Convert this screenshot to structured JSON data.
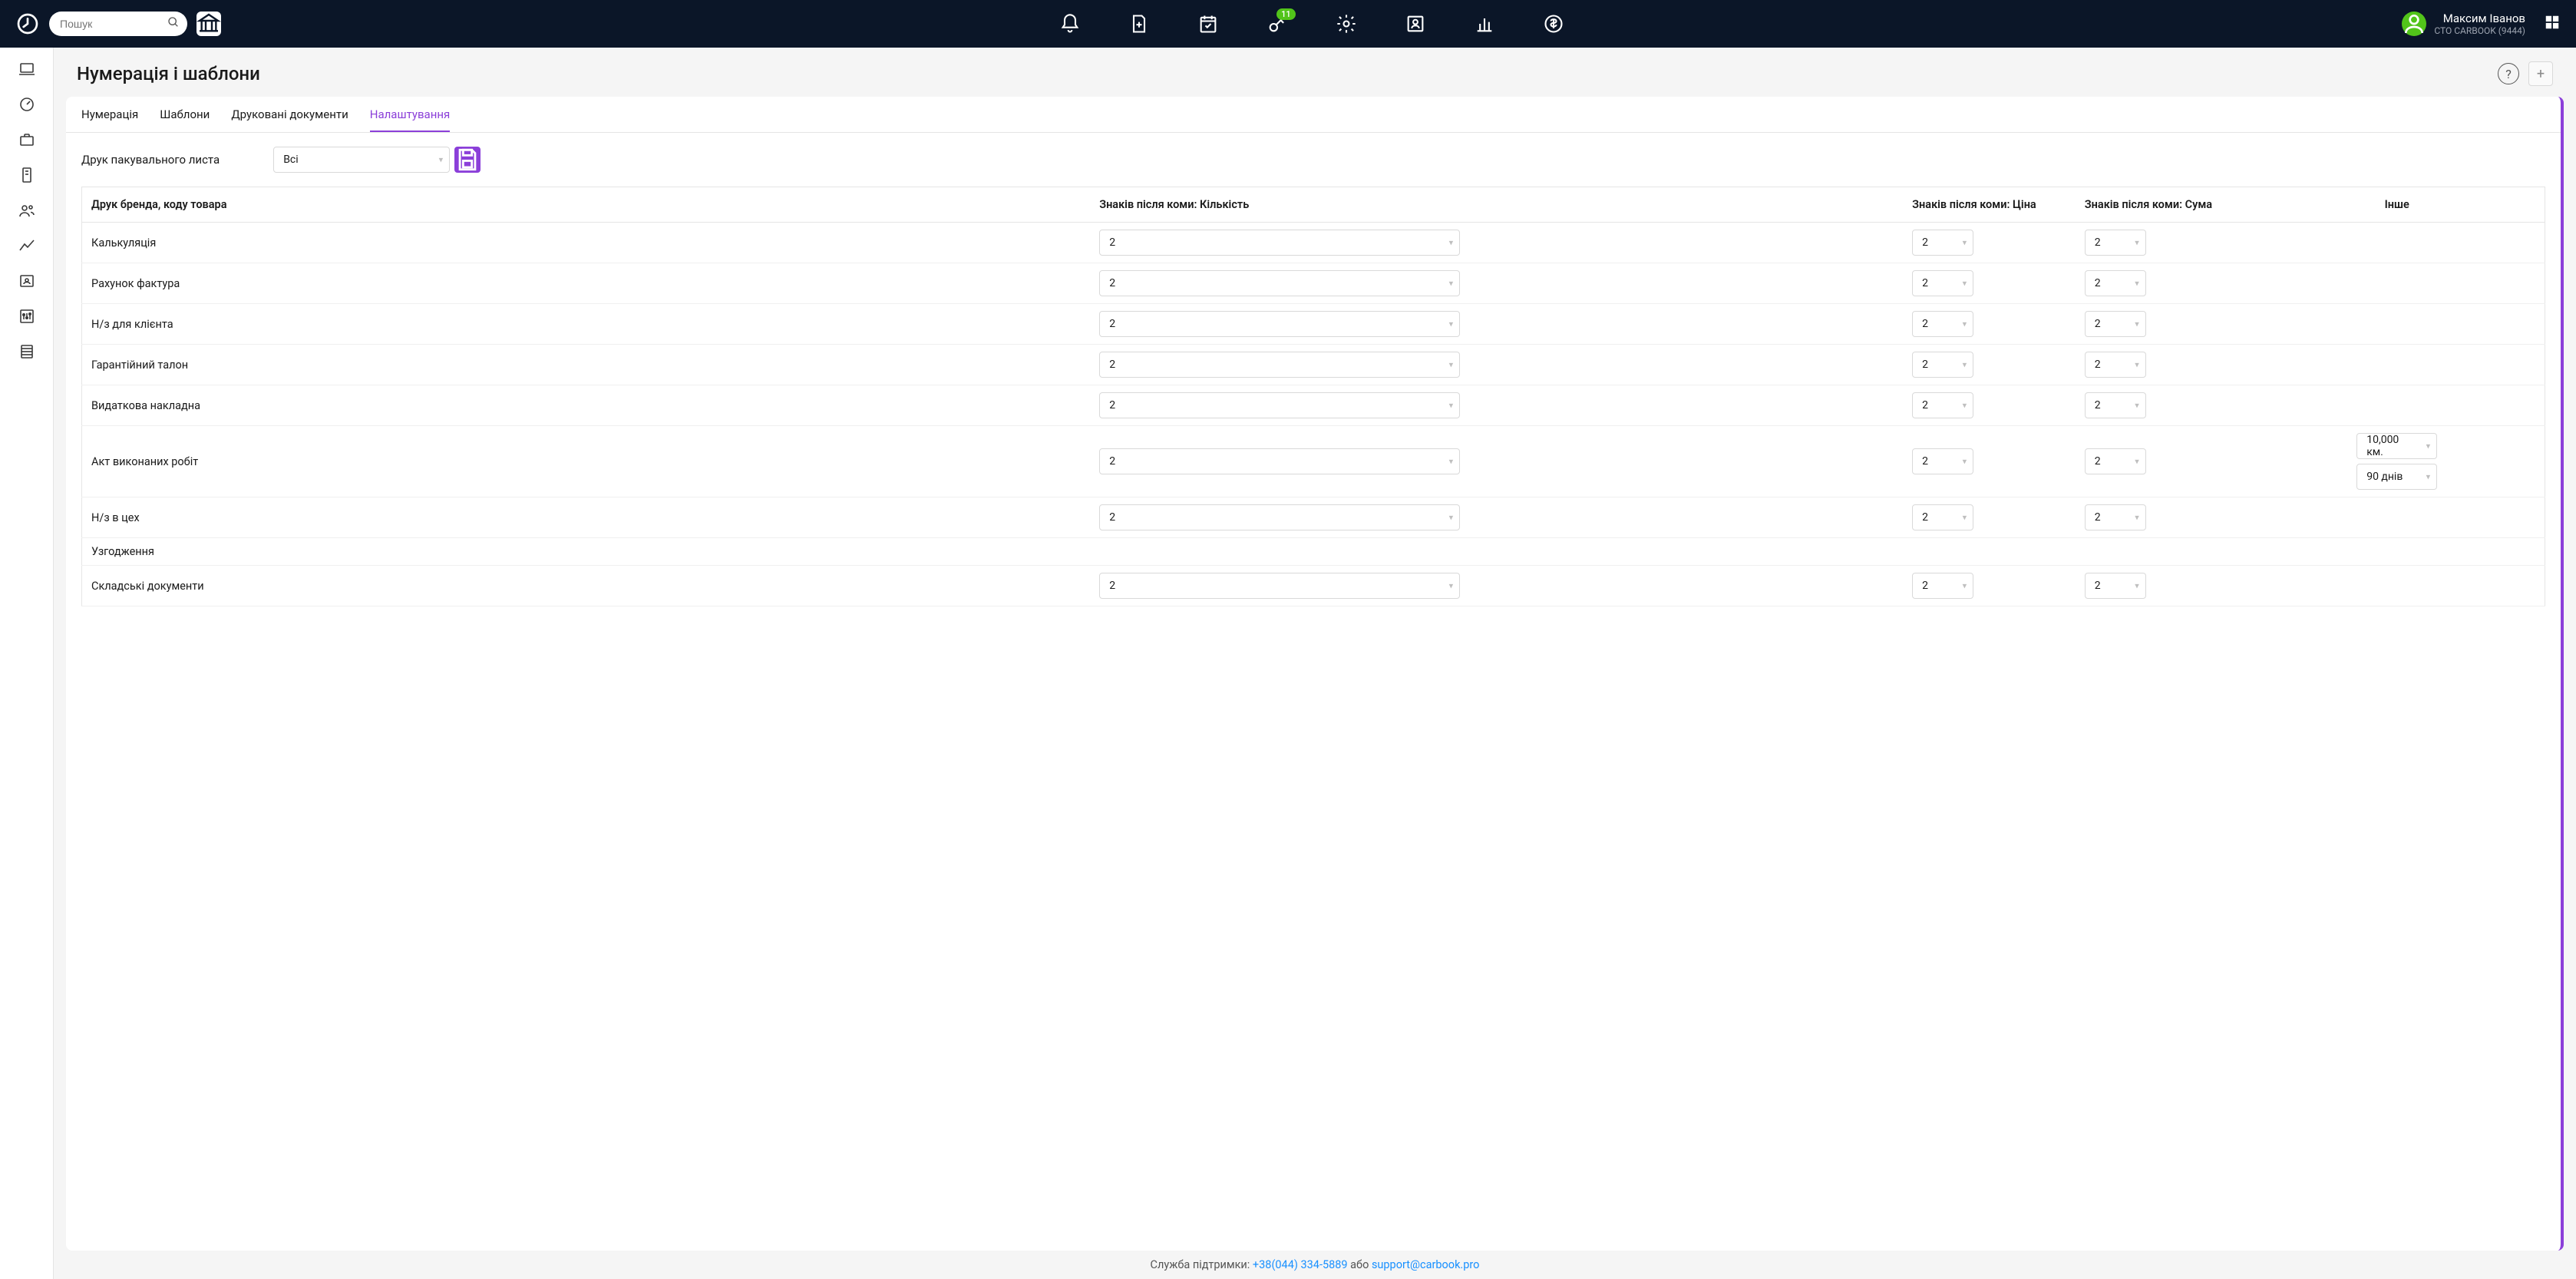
{
  "topbar": {
    "search_placeholder": "Пошук",
    "badge_count": "11",
    "user_name": "Максим Іванов",
    "shop_name": "СТО CARBOOK (9444)"
  },
  "page": {
    "title": "Нумерація і шаблони"
  },
  "tabs": [
    "Нумерація",
    "Шаблони",
    "Друковані документи",
    "Налаштування"
  ],
  "active_tab_index": 3,
  "filter": {
    "label": "Друк пакувального листа",
    "value": "Всі"
  },
  "table": {
    "headers": {
      "name": "Друк бренда, коду товара",
      "qty": "Знаків після коми: Кількість",
      "price": "Знаків після коми: Ціна",
      "sum": "Знаків після коми: Сума",
      "other": "Інше"
    },
    "rows": [
      {
        "name": "Калькуляція",
        "qty": "2",
        "price": "2",
        "sum": "2",
        "other": null
      },
      {
        "name": "Рахунок фактура",
        "qty": "2",
        "price": "2",
        "sum": "2",
        "other": null
      },
      {
        "name": "Н/з для клієнта",
        "qty": "2",
        "price": "2",
        "sum": "2",
        "other": null
      },
      {
        "name": "Гарантійний талон",
        "qty": "2",
        "price": "2",
        "sum": "2",
        "other": null
      },
      {
        "name": "Видаткова накладна",
        "qty": "2",
        "price": "2",
        "sum": "2",
        "other": null
      },
      {
        "name": "Акт виконаних робіт",
        "qty": "2",
        "price": "2",
        "sum": "2",
        "other": [
          "10,000 км.",
          "90 днів"
        ]
      },
      {
        "name": "Н/з в цех",
        "qty": "2",
        "price": "2",
        "sum": "2",
        "other": null
      },
      {
        "name": "Узгодження",
        "qty": null,
        "price": null,
        "sum": null,
        "other": null
      },
      {
        "name": "Складські документи",
        "qty": "2",
        "price": "2",
        "sum": "2",
        "other": null
      }
    ]
  },
  "footer": {
    "prefix": "Служба підтримки: ",
    "phone": "+38(044) 334-5889",
    "middle": " або ",
    "email": "support@carbook.pro"
  }
}
